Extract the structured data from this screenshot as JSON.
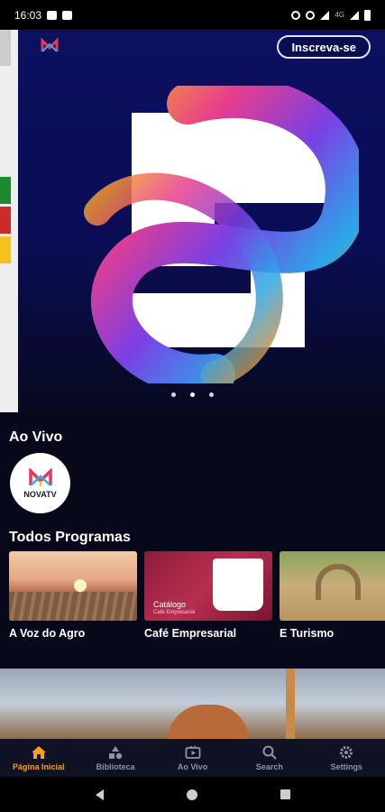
{
  "status_bar": {
    "time": "16:03",
    "network": "4G",
    "icons": [
      "tv-icon",
      "folder-icon",
      "alarm-icon",
      "eye-icon",
      "wifi-icon",
      "signal-icon",
      "battery-icon"
    ]
  },
  "hero": {
    "subscribe_label": "Inscreva-se",
    "carousel_count": 3,
    "carousel_active": 2
  },
  "live": {
    "title": "Ao Vivo",
    "channel_name": "NOVATV"
  },
  "programs": {
    "title": "Todos Programas",
    "items": [
      {
        "title": "A Voz do Agro"
      },
      {
        "title": "Café Empresarial",
        "caption": "Catálogo",
        "caption_sub": "Café Empresarial"
      },
      {
        "title": "E Turismo"
      }
    ]
  },
  "bottom_nav": {
    "items": [
      {
        "label": "Página Inicial",
        "icon": "home-icon",
        "active": true
      },
      {
        "label": "Biblioteca",
        "icon": "shapes-icon",
        "active": false
      },
      {
        "label": "Ao Vivo",
        "icon": "tv-play-icon",
        "active": false
      },
      {
        "label": "Search",
        "icon": "search-icon",
        "active": false
      },
      {
        "label": "Settings",
        "icon": "gear-icon",
        "active": false
      }
    ]
  },
  "colors": {
    "accent": "#f5a11a",
    "background": "#07091a",
    "hero_blue": "#0b1060"
  }
}
